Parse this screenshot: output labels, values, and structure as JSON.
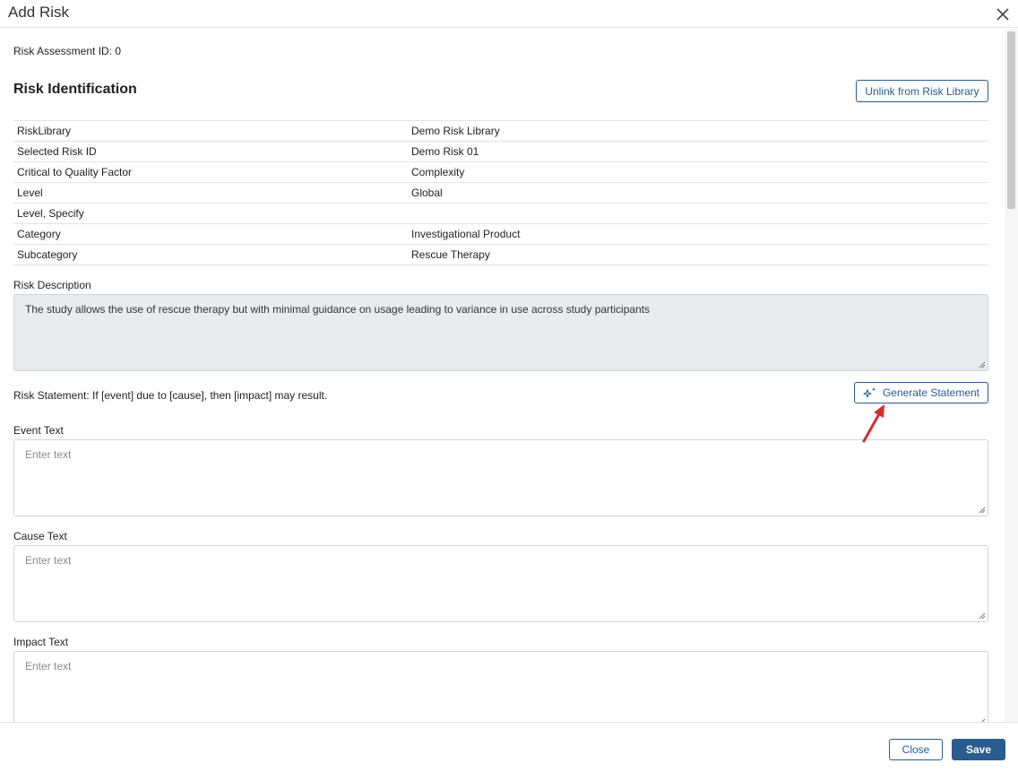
{
  "dialog": {
    "title": "Add Risk"
  },
  "assessment": {
    "id_label": "Risk Assessment ID: 0"
  },
  "identification": {
    "title": "Risk Identification",
    "unlink_label": "Unlink from Risk Library",
    "rows": [
      {
        "label": "RiskLibrary",
        "value": "Demo Risk Library"
      },
      {
        "label": "Selected Risk ID",
        "value": "Demo Risk 01"
      },
      {
        "label": "Critical to Quality Factor",
        "value": "Complexity"
      },
      {
        "label": "Level",
        "value": "Global"
      },
      {
        "label": "Level, Specify",
        "value": ""
      },
      {
        "label": "Category",
        "value": "Investigational Product"
      },
      {
        "label": "Subcategory",
        "value": "Rescue Therapy"
      }
    ]
  },
  "description": {
    "label": "Risk Description",
    "value": "The study allows the use of rescue therapy but with minimal guidance on usage leading to variance in use across study participants"
  },
  "statement": {
    "text": "Risk Statement: If [event] due to [cause], then [impact] may result.",
    "generate_label": "Generate Statement"
  },
  "event": {
    "label": "Event Text",
    "placeholder": "Enter text"
  },
  "cause": {
    "label": "Cause Text",
    "placeholder": "Enter text"
  },
  "impact": {
    "label": "Impact Text",
    "placeholder": "Enter text"
  },
  "footer": {
    "close_label": "Close",
    "save_label": "Save"
  },
  "colors": {
    "accent": "#2a5c8f",
    "annotation_arrow": "#d32f2f",
    "readonly_bg": "#e9ecef"
  }
}
